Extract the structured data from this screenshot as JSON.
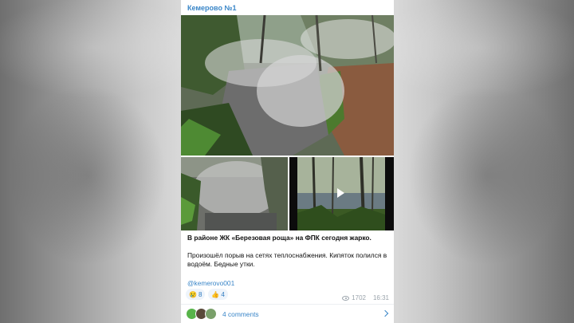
{
  "post": {
    "channel_name": "Кемерово №1",
    "title": "В районе ЖК «Березовая роща» на ФПК сегодня жарко.",
    "body": "Произошёл порыв на сетях теплоснабжения. Кипяток полился в водоём. Бедные утки.",
    "hashtag": "@kemerovo001",
    "reactions": [
      {
        "icon": "crying-face-icon",
        "emoji": "😢",
        "count": "8"
      },
      {
        "icon": "thumbs-up-icon",
        "emoji": "👍",
        "count": "4"
      }
    ],
    "views": "1702",
    "time": "16:31",
    "comments_label": "4 comments"
  },
  "colors": {
    "accent": "#3a86c8",
    "card_background": "#ffffff",
    "meta_text": "#9aa3ab"
  }
}
